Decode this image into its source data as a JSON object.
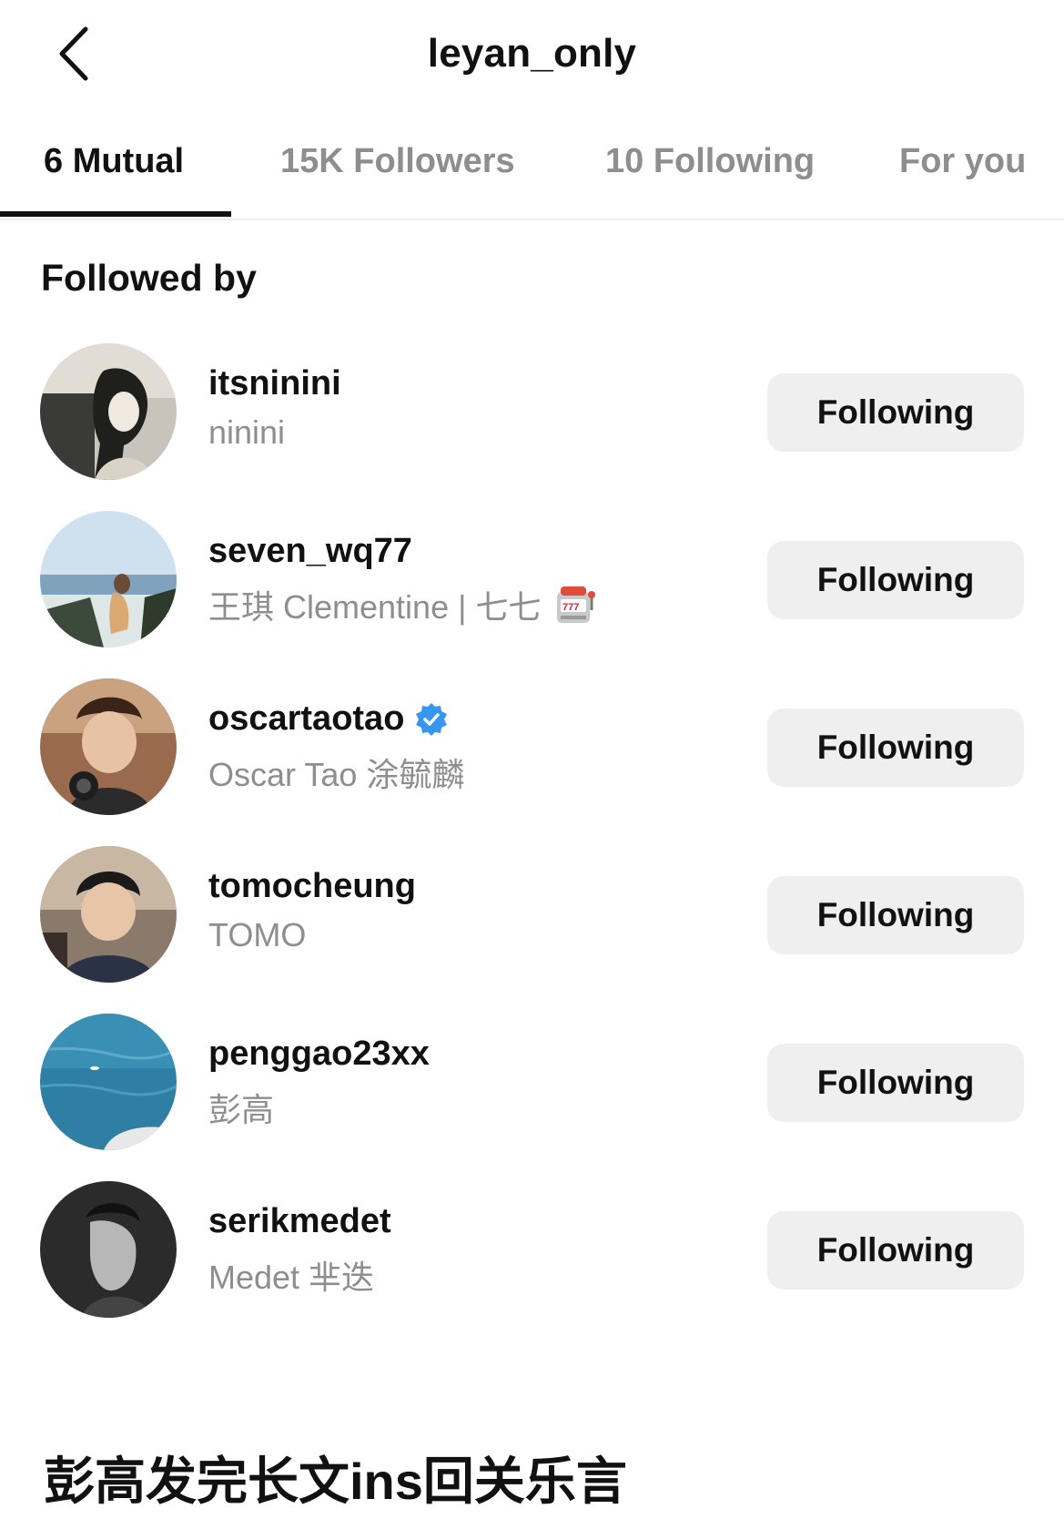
{
  "header": {
    "title": "leyan_only",
    "back_icon": "chevron-left-icon"
  },
  "tabs": [
    {
      "label": "6 Mutual",
      "active": true
    },
    {
      "label": "15K Followers",
      "active": false
    },
    {
      "label": "10 Following",
      "active": false
    },
    {
      "label": "For you",
      "active": false
    }
  ],
  "section": {
    "heading": "Followed by"
  },
  "users": [
    {
      "username": "itsninini",
      "fullname": "ninini",
      "verified": false,
      "button_label": "Following"
    },
    {
      "username": "seven_wq77",
      "fullname": "王琪 Clementine | 七七",
      "verified": false,
      "emoji_icon": "slot-machine-icon",
      "button_label": "Following"
    },
    {
      "username": "oscartaotao",
      "fullname": "Oscar Tao 涂毓麟",
      "verified": true,
      "button_label": "Following"
    },
    {
      "username": "tomocheung",
      "fullname": "TOMO",
      "verified": false,
      "button_label": "Following"
    },
    {
      "username": "penggao23xx",
      "fullname": "彭高",
      "verified": false,
      "button_label": "Following"
    },
    {
      "username": "serikmedet",
      "fullname": "Medet 芈迭",
      "verified": false,
      "button_label": "Following"
    }
  ],
  "caption": "彭高发完长文ins回关乐言",
  "colors": {
    "text_primary": "#111111",
    "text_secondary": "#8e8e8e",
    "button_bg": "#efefef",
    "verified_blue": "#3797f0"
  }
}
